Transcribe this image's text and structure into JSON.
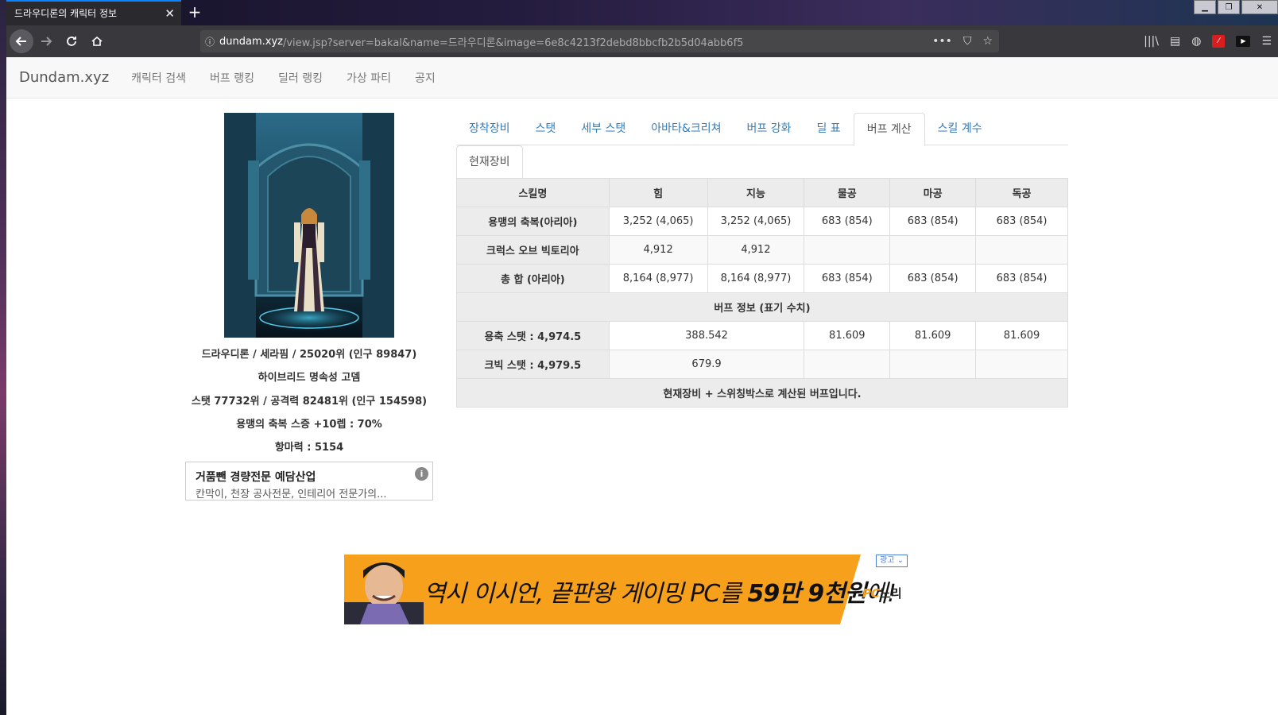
{
  "browser": {
    "tab_title": "드라우디론의 캐릭터 정보",
    "tab_close": "✕",
    "new_tab": "+",
    "url_host": "dundam.xyz",
    "url_path": "/view.jsp?server=bakal&name=드라우디론&image=6e8c4213f2debd8bbcfb2b5d04abb6f5"
  },
  "site": {
    "brand": "Dundam.xyz",
    "nav": [
      "캐릭터 검색",
      "버프 랭킹",
      "딜러 랭킹",
      "가상 파티",
      "공지"
    ]
  },
  "character": {
    "info_lines": [
      "드라우디론 / 세라핌 / 25020위 (인구 89847)",
      "하이브리드 명속성 고뎀",
      "스탯 77732위 / 공격력 82481위 (인구 154598)",
      "용맹의 축복 스증 +10렙 : 70%",
      "항마력 : 5154"
    ]
  },
  "side_ad": {
    "title": "거품뺀 경량전문 예담산업",
    "desc": "칸막이, 천장 공사전문, 인테리어 전문가의..."
  },
  "tabs": {
    "main": [
      "장착장비",
      "스탯",
      "세부 스탯",
      "아바타&크리쳐",
      "버프 강화",
      "딜 표",
      "버프 계산",
      "스킬 계수"
    ],
    "active_index": 6,
    "sub": [
      "현재장비"
    ]
  },
  "buff_table": {
    "headers": [
      "스킬명",
      "힘",
      "지능",
      "물공",
      "마공",
      "독공"
    ],
    "rows": [
      [
        "용맹의 축복(아리아)",
        "3,252 (4,065)",
        "3,252 (4,065)",
        "683 (854)",
        "683 (854)",
        "683 (854)"
      ],
      [
        "크럭스 오브 빅토리아",
        "4,912",
        "4,912",
        "",
        "",
        ""
      ],
      [
        "총 합 (아리아)",
        "8,164 (8,977)",
        "8,164 (8,977)",
        "683 (854)",
        "683 (854)",
        "683 (854)"
      ]
    ],
    "section_title": "버프 정보 (표기 수치)",
    "info_rows": [
      {
        "label": "용축 스탯 : 4,974.5",
        "stat": "388.542",
        "phys": "81.609",
        "mag": "81.609",
        "ind": "81.609"
      },
      {
        "label": "크빅 스탯 : 4,979.5",
        "stat": "679.9",
        "phys": "",
        "mag": "",
        "ind": ""
      }
    ],
    "footer": "현재장비 + 스위칭박스로 계산된 버프입니다."
  },
  "banner": {
    "text_a": "역시 이시언, 끝판왕 게이밍 PC를 ",
    "text_b": "59만 9천원",
    "text_c": "에!",
    "logo_pc": "PC",
    "logo_name": "노리",
    "ad_label": "광고 ⌄"
  }
}
